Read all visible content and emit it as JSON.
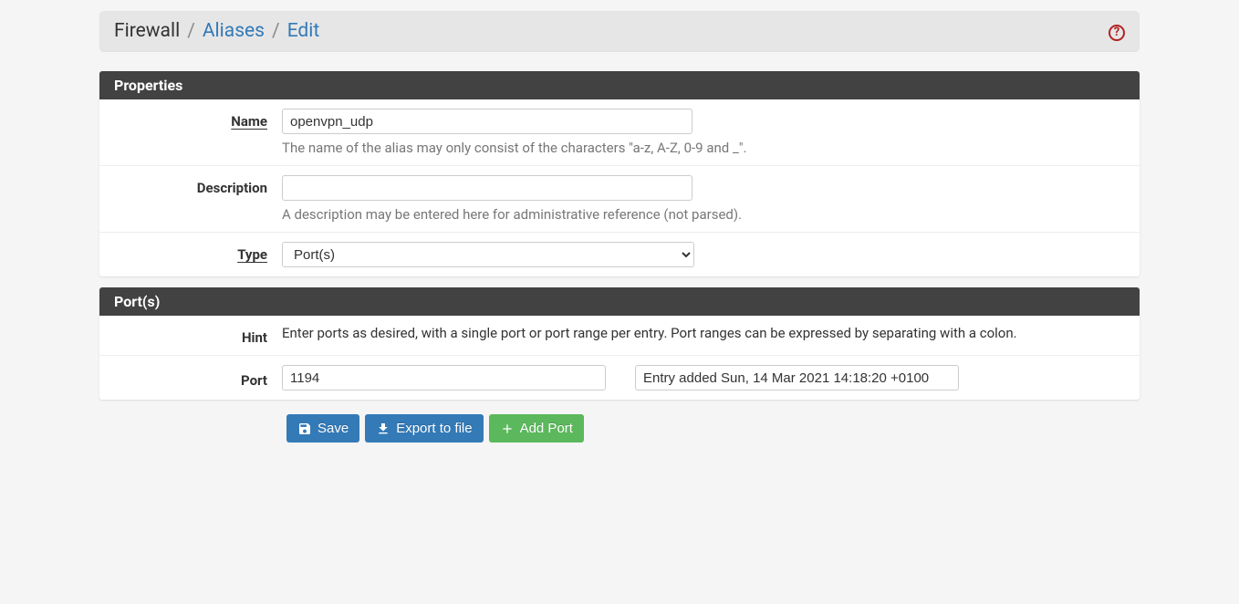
{
  "breadcrumb": {
    "root": "Firewall",
    "mid": "Aliases",
    "leaf": "Edit",
    "sep": "/"
  },
  "panels": {
    "properties": {
      "title": "Properties"
    },
    "ports": {
      "title": "Port(s)"
    }
  },
  "fields": {
    "name": {
      "label": "Name",
      "value": "openvpn_udp",
      "help": "The name of the alias may only consist of the characters \"a-z, A-Z, 0-9 and _\"."
    },
    "description": {
      "label": "Description",
      "value": "",
      "help": "A description may be entered here for administrative reference (not parsed)."
    },
    "type": {
      "label": "Type",
      "selected": "Port(s)"
    },
    "hint": {
      "label": "Hint",
      "text": "Enter ports as desired, with a single port or port range per entry. Port ranges can be expressed by separating with a colon."
    },
    "port": {
      "label": "Port",
      "value": "1194",
      "note": "Entry added Sun, 14 Mar 2021 14:18:20 +0100"
    }
  },
  "buttons": {
    "save": "Save",
    "export": "Export to file",
    "addport": "Add Port"
  }
}
